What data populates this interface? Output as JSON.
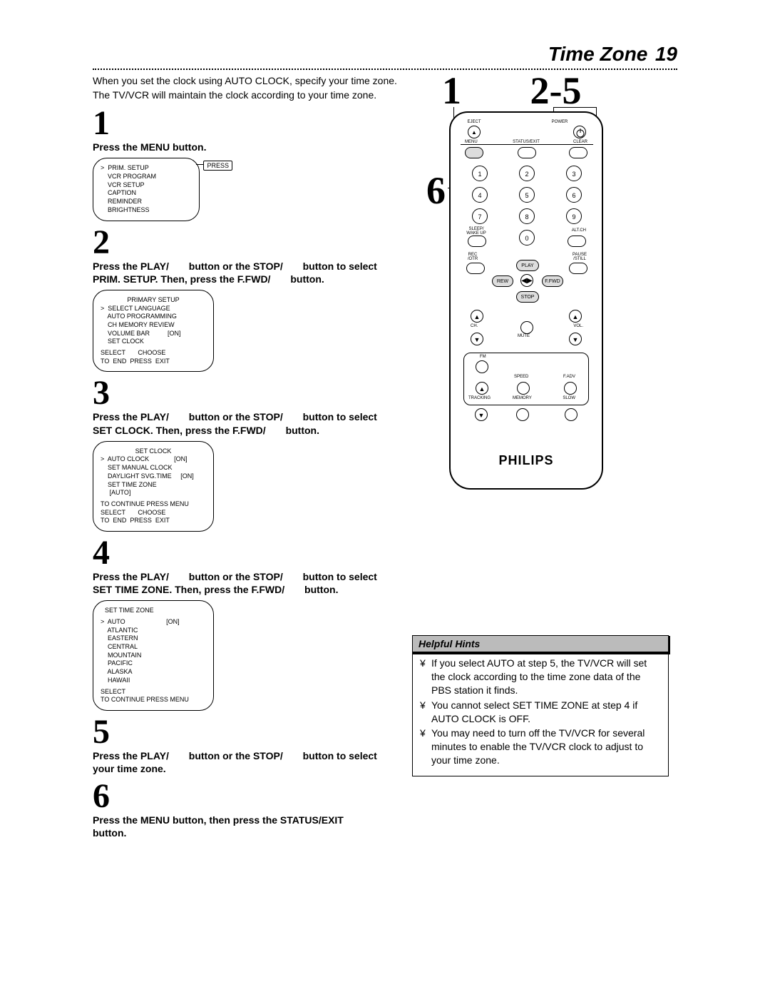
{
  "title": "Time Zone",
  "page_number": "19",
  "intro_line1": "When you set the clock using AUTO CLOCK, specify your time zone.",
  "intro_line2": "The TV/VCR will maintain the clock according to your time zone.",
  "callout_1": "1",
  "callout_25": "2-5",
  "callout_6": "6",
  "steps": {
    "s1": {
      "num": "1",
      "text": "Press the MENU button."
    },
    "s2": {
      "num": "2",
      "line1a": "Press the PLAY/",
      "line1b": "button or the STOP/",
      "line1c": "button to select",
      "line2a": "PRIM. SETUP.  Then, press the F.FWD/",
      "line2b": "button."
    },
    "s3": {
      "num": "3",
      "line1a": "Press the PLAY/",
      "line1b": "button or the STOP/",
      "line1c": "button to select",
      "line2a": "SET CLOCK. Then, press the F.FWD/",
      "line2b": "button."
    },
    "s4": {
      "num": "4",
      "line1a": "Press the PLAY/",
      "line1b": "button or the STOP/",
      "line1c": "button to select",
      "line2a": "SET TIME ZONE. Then, press the F.FWD/",
      "line2b": "button."
    },
    "s5": {
      "num": "5",
      "line1a": "Press the PLAY/",
      "line1b": "button or the STOP/",
      "line1c": "button to select",
      "line2": "your time zone."
    },
    "s6": {
      "num": "6",
      "line1": "Press the MENU button, then press the STATUS/EXIT",
      "line2": "button."
    }
  },
  "screen1": {
    "press": "PRESS",
    "r1": ">  PRIM. SETUP",
    "r2": "    VCR PROGRAM",
    "r3": "    VCR SETUP",
    "r4": "    CAPTION",
    "r5": "    REMINDER",
    "r6": "    BRIGHTNESS"
  },
  "screen2": {
    "hdr": "PRIMARY SETUP",
    "r1": ">  SELECT LANGUAGE",
    "r2": "    AUTO PROGRAMMING",
    "r3": "    CH MEMORY REVIEW",
    "r4": "    VOLUME BAR          [ON]",
    "r5": "    SET CLOCK",
    "f1": "SELECT       CHOOSE",
    "f2": "TO  END  PRESS  EXIT"
  },
  "screen3": {
    "hdr": "SET CLOCK",
    "r1": ">  AUTO CLOCK              [ON]",
    "r2": "    SET MANUAL CLOCK",
    "r3": "    DAYLIGHT SVG.TIME     [ON]",
    "r4": "    SET TIME ZONE",
    "r5": "     [AUTO]",
    "m1": "TO CONTINUE PRESS MENU",
    "f1": "SELECT       CHOOSE",
    "f2": "TO  END  PRESS  EXIT"
  },
  "screen4": {
    "hdr": "SET TIME ZONE",
    "r1": ">  AUTO                       [ON]",
    "r2": "    ATLANTIC",
    "r3": "    EASTERN",
    "r4": "    CENTRAL",
    "r5": "    MOUNTAIN",
    "r6": "    PACIFIC",
    "r7": "    ALASKA",
    "r8": "    HAWAII",
    "f1": "SELECT",
    "f2": "TO CONTINUE PRESS MENU"
  },
  "remote": {
    "eject_lbl": "EJECT",
    "power_lbl": "POWER",
    "menu_lbl": "MENU",
    "status_lbl": "STATUS/EXIT",
    "clear_lbl": "CLEAR",
    "sleep_lbl": "SLEEP/\nWAKE UP",
    "altch_lbl": "ALT.CH",
    "rec_lbl": "REC\n/OTR",
    "pause_lbl": "PAUSE\n/STILL",
    "play": "PLAY",
    "rew": "REW",
    "ffwd": "F.FWD",
    "stop": "STOP",
    "ch_lbl": "CH.",
    "vol_lbl": "VOL.",
    "mute_lbl": "MUTE",
    "fm_lbl": "FM",
    "speed_lbl": "SPEED",
    "fadv_lbl": "F.ADV",
    "tracking_lbl": "TRACKING",
    "memory_lbl": "MEMORY",
    "slow_lbl": "SLOW",
    "n0": "0",
    "n1": "1",
    "n2": "2",
    "n3": "3",
    "n4": "4",
    "n5": "5",
    "n6": "6",
    "n7": "7",
    "n8": "8",
    "n9": "9",
    "brand": "PHILIPS"
  },
  "hints": {
    "title": "Helpful Hints",
    "bullet": "¥",
    "h1": "If you select AUTO at step 5, the TV/VCR will set the clock according to the time zone data of the PBS station it finds.",
    "h2": "You cannot select SET TIME ZONE at step 4 if AUTO CLOCK is OFF.",
    "h3": "You may need to turn off the TV/VCR for several minutes to enable the TV/VCR clock to adjust to your time zone."
  }
}
